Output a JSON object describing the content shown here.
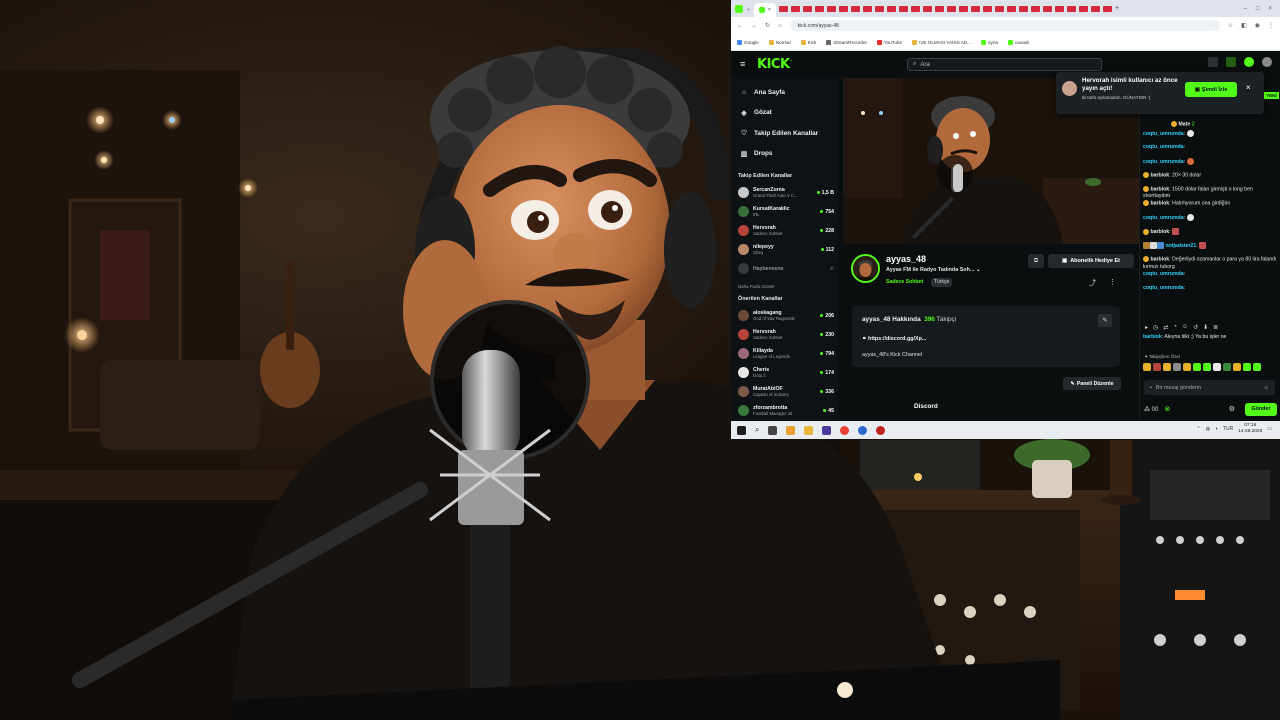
{
  "browser": {
    "address": "kick.com/ayyas-48",
    "bookmarks": [
      "Google",
      "Normal",
      "Kick",
      "StreamRecorder",
      "YouTube",
      "!VE OLMASI YAHIS AD...",
      "ayna",
      "canaslı"
    ]
  },
  "kick": {
    "logo": "KICK",
    "search_placeholder": "Ara",
    "nav": [
      {
        "label": "Ana Sayfa",
        "icon": "home-icon"
      },
      {
        "label": "Gözat",
        "icon": "compass-icon"
      },
      {
        "label": "Takip Edilen Kanallar",
        "icon": "heart-icon"
      },
      {
        "label": "Drops",
        "icon": "drops-icon"
      }
    ],
    "followed_title": "Takip Edilen Kanallar",
    "followed": [
      {
        "name": "SercanZurna",
        "game": "Grand Theft Auto V C...",
        "count": "1,5 B",
        "color": "#c9c9c9"
      },
      {
        "name": "KursatKaraklic",
        "game": "IRL",
        "count": "754",
        "color": "#3a6e3a"
      },
      {
        "name": "Hervorah",
        "game": "Sadece Sohbet",
        "count": "228",
        "color": "#b5453a"
      },
      {
        "name": "nilepeyy",
        "game": "Obey",
        "count": "112",
        "color": "#b88a6a"
      },
      {
        "name": "Haybeneene",
        "game": "",
        "count": "",
        "color": "#555c60"
      }
    ],
    "show_more": "Daha Fazla Göster",
    "recommended_title": "Önerilen Kanallar",
    "recommended": [
      {
        "name": "aloskagang",
        "game": "God of War Ragnarök",
        "count": "206",
        "color": "#6e4a3a"
      },
      {
        "name": "Hervorah",
        "game": "Sadece Sohbet",
        "count": "230",
        "color": "#b5453a"
      },
      {
        "name": "Killayda",
        "game": "League of Legends",
        "count": "794",
        "color": "#9a6a7a"
      },
      {
        "name": "Cheris",
        "game": "Dota 2",
        "count": "174",
        "color": "#e8e8e8"
      },
      {
        "name": "MuratAbiOF",
        "game": "Captain of Industry",
        "count": "336",
        "color": "#7a5a4a"
      },
      {
        "name": "zforzambrotta",
        "game": "Football Manager 26",
        "count": "45",
        "color": "#3a7a3a"
      }
    ],
    "streamer": {
      "name": "ayyas_48",
      "title": "Ayyas FM ile Radyo Tadında Soh...",
      "category": "Sadece Sohbet",
      "language": "Türkçe",
      "gift_button": "Abonelik Hediye Et"
    },
    "about": {
      "title": "ayyas_48 Hakkında",
      "followers": "396",
      "followers_label": "Takipçi",
      "link": "https://discord.gg/Xp...",
      "description": "ayyas_48's Kick Channel",
      "panel_button": "Paneli Düzenle",
      "discord_label": "Discord"
    },
    "notification": {
      "title": "Hervorah isimli kullanıcı az önce yayın açtı!",
      "subtitle": "Bi türlü ayılamadım. GÜNAYDIN :(",
      "button": "Şimdi İzle",
      "new_tag": "YENİ"
    },
    "chat": {
      "top_user": "Mate",
      "top_user_count": "2",
      "messages": [
        {
          "user": "coqtu_umrumda",
          "text": ":",
          "color": "#2fd3ff"
        },
        {
          "user": "coqtu_umrumda",
          "text": ":",
          "color": "#2fd3ff"
        },
        {
          "user": "coqtu_umrumda",
          "text": ":",
          "color": "#2fd3ff"
        },
        {
          "user": "barbiok",
          "text": "20× 30 dolar",
          "color": "#e8e8e8"
        },
        {
          "user": "barbiok",
          "text": "1500 dolar falan girmişti o long ben shorttaydım",
          "color": "#e8e8e8"
        },
        {
          "user": "barbiok",
          "text": "Hatırlıyorum ona girdiğini",
          "color": "#e8e8e8"
        },
        {
          "user": "coqtu_umrumda",
          "text": ":",
          "color": "#2fd3ff"
        },
        {
          "user": "barbiok",
          "text": ":",
          "color": "#e8e8e8"
        },
        {
          "user": "notjadster21",
          "text": ":",
          "color": "#2fd3ff"
        },
        {
          "user": "barbiok",
          "text": "Değerliydi ozamanlar o para ya 80 lira falandı kırmızı tuborg",
          "color": "#e8e8e8"
        },
        {
          "user": "coqtu_umrumda",
          "text": ":",
          "color": "#2fd3ff"
        },
        {
          "user": "coqtu_umrumda",
          "text": ":",
          "color": "#2fd3ff"
        },
        {
          "user": "barbiok",
          "text": "Aleyna tilki ;)  Ya bu işler ne",
          "color": "#2fd3ff"
        }
      ],
      "follower_only": "Takipçilere Özel",
      "input_placeholder": "Bir mesaj gönderin",
      "points": "00",
      "send": "Gönder"
    }
  },
  "taskbar": {
    "time": "07:16",
    "date": "14.08.2026",
    "lang": "TUR"
  }
}
